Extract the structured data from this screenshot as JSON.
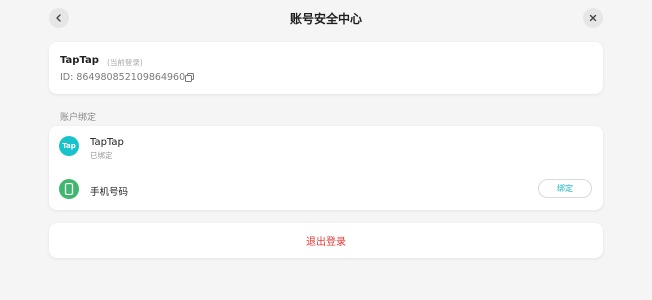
{
  "header": {
    "title": "账号安全中心"
  },
  "account": {
    "name": "TapTap",
    "tag": "(当前登录)",
    "id_text": "ID: 864980852109864960"
  },
  "binding": {
    "section_label": "账户绑定",
    "items": [
      {
        "icon_text": "Tap",
        "title": "TapTap",
        "status": "已绑定"
      },
      {
        "title": "手机号码",
        "button_label": "绑定"
      }
    ]
  },
  "logout": {
    "label": "退出登录"
  },
  "colors": {
    "taptap_brand": "#19c3cc",
    "phone_icon": "#3fb86e",
    "logout_text": "#e53935"
  },
  "icons": [
    "chevron-left-icon",
    "close-icon",
    "copy-icon",
    "taptap-logo-icon",
    "phone-icon"
  ]
}
